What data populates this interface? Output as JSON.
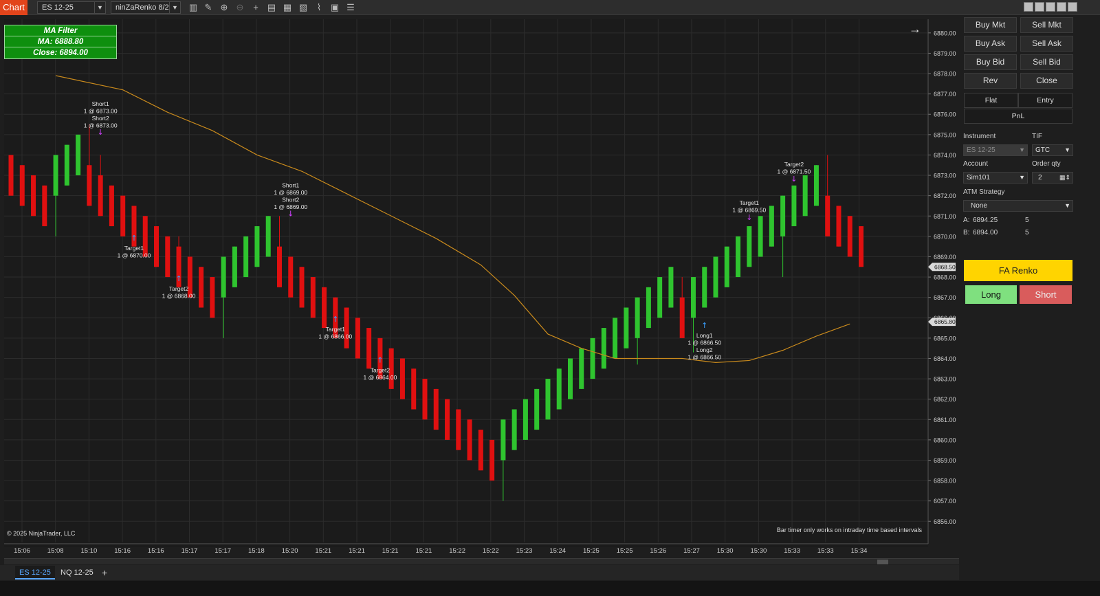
{
  "toolbar": {
    "chart_tab": "Chart",
    "instrument": "ES 12-25",
    "bar_type": "ninZaRenko 8/2",
    "icons": [
      "bar-style-icon",
      "draw-tool-icon",
      "zoom-in-icon",
      "zoom-out-icon",
      "crosshair-icon",
      "data-series-icon",
      "templates-icon",
      "indicators-icon",
      "strategies-icon",
      "properties-icon",
      "object-tree-icon"
    ]
  },
  "ma_filter": {
    "title": "MA Filter",
    "ma": "MA: 6888.80",
    "close": "Close: 6894.00"
  },
  "copyright": "© 2025 NinjaTrader, LLC",
  "bar_timer": "Bar timer only works on intraday time based intervals",
  "bottom_tabs": {
    "tab1": "ES 12-25",
    "tab2": "NQ 12-25",
    "add": "+"
  },
  "panel": {
    "buy_mkt": "Buy Mkt",
    "sell_mkt": "Sell Mkt",
    "buy_ask": "Buy Ask",
    "sell_ask": "Sell Ask",
    "buy_bid": "Buy Bid",
    "sell_bid": "Sell Bid",
    "rev": "Rev",
    "close": "Close",
    "flat": "Flat",
    "entry": "Entry",
    "pnl": "PnL",
    "instrument_label": "Instrument",
    "instrument_value": "ES 12-25",
    "tif_label": "TIF",
    "tif_value": "GTC",
    "account_label": "Account",
    "account_value": "Sim101",
    "qty_label": "Order qty",
    "qty_value": "2",
    "atm_label": "ATM Strategy",
    "atm_value": "None",
    "ask_label": "A:",
    "ask_price": "6894.25",
    "ask_size": "5",
    "bid_label": "B:",
    "bid_price": "6894.00",
    "bid_size": "5",
    "fa_renko": "FA Renko",
    "long": "Long",
    "short": "Short"
  },
  "colors": {
    "up": "#2fc42f",
    "down": "#e01010",
    "ma": "#c98a1c",
    "background": "#1e1e1e",
    "grid": "#2c2c2c"
  },
  "chart_data": {
    "type": "renko-candlestick",
    "y_axis_ticks": [
      6880,
      6879,
      6878,
      6877,
      6876,
      6875,
      6874,
      6873,
      6872,
      6871,
      6870,
      6869,
      6868,
      6867,
      6866,
      6865,
      6864,
      6863,
      6862,
      6861,
      6860,
      6859,
      6858,
      6857,
      6856
    ],
    "y_tick_labels": [
      "6880.00",
      "6879.00",
      "6878.00",
      "6877.00",
      "6876.00",
      "6875.00",
      "6874.00",
      "6873.00",
      "6872.00",
      "6871.00",
      "6870.00",
      "6869.00",
      "6868.00",
      "6867.00",
      "6866.00",
      "6865.00",
      "6864.00",
      "6863.00",
      "6862.00",
      "6861.00",
      "6860.00",
      "6859.00",
      "6858.00",
      "6057.00",
      "6856.00"
    ],
    "ylim": [
      6855.3,
      6880.4
    ],
    "price_markers": [
      "6868.50",
      "6865.80"
    ],
    "price_marker_values": [
      6868.5,
      6865.8
    ],
    "x_tick_labels": [
      "15:06",
      "15:08",
      "15:10",
      "15:16",
      "15:16",
      "15:17",
      "15:17",
      "15:18",
      "15:20",
      "15:21",
      "15:21",
      "15:21",
      "15:21",
      "15:22",
      "15:22",
      "15:23",
      "15:24",
      "15:25",
      "15:25",
      "15:26",
      "15:27",
      "15:30",
      "15:30",
      "15:33",
      "15:33",
      "15:34"
    ],
    "bars": [
      {
        "o": 6874,
        "c": 6872,
        "h": 6874,
        "l": 6872
      },
      {
        "o": 6873.5,
        "c": 6871.5,
        "h": 6873.5,
        "l": 6871.5
      },
      {
        "o": 6873,
        "c": 6871,
        "h": 6873,
        "l": 6871
      },
      {
        "o": 6872.5,
        "c": 6870.5,
        "h": 6872.5,
        "l": 6870.5
      },
      {
        "o": 6872,
        "c": 6874,
        "h": 6874,
        "l": 6870
      },
      {
        "o": 6872.5,
        "c": 6874.5,
        "h": 6874.5,
        "l": 6872.5
      },
      {
        "o": 6873,
        "c": 6875,
        "h": 6875,
        "l": 6873
      },
      {
        "o": 6873.5,
        "c": 6871.5,
        "h": 6875.5,
        "l": 6871.5
      },
      {
        "o": 6873,
        "c": 6871,
        "h": 6874,
        "l": 6871
      },
      {
        "o": 6872.5,
        "c": 6870.5,
        "h": 6872.5,
        "l": 6870.5
      },
      {
        "o": 6872,
        "c": 6870,
        "h": 6872,
        "l": 6870
      },
      {
        "o": 6871.5,
        "c": 6869.5,
        "h": 6871.5,
        "l": 6869.5
      },
      {
        "o": 6871,
        "c": 6869,
        "h": 6871,
        "l": 6869
      },
      {
        "o": 6870.5,
        "c": 6868.5,
        "h": 6870.5,
        "l": 6868.5
      },
      {
        "o": 6870,
        "c": 6868,
        "h": 6870,
        "l": 6868
      },
      {
        "o": 6869.5,
        "c": 6867.5,
        "h": 6870,
        "l": 6867.5
      },
      {
        "o": 6869,
        "c": 6867,
        "h": 6869,
        "l": 6867
      },
      {
        "o": 6868.5,
        "c": 6866.5,
        "h": 6868.5,
        "l": 6866.5
      },
      {
        "o": 6868,
        "c": 6866,
        "h": 6868,
        "l": 6866
      },
      {
        "o": 6867,
        "c": 6869,
        "h": 6869,
        "l": 6865
      },
      {
        "o": 6867.5,
        "c": 6869.5,
        "h": 6869.5,
        "l": 6867.5
      },
      {
        "o": 6868,
        "c": 6870,
        "h": 6870,
        "l": 6868
      },
      {
        "o": 6868.5,
        "c": 6870.5,
        "h": 6870.5,
        "l": 6868.5
      },
      {
        "o": 6869,
        "c": 6871,
        "h": 6871,
        "l": 6869
      },
      {
        "o": 6869.5,
        "c": 6867.5,
        "h": 6871,
        "l": 6867.5
      },
      {
        "o": 6869,
        "c": 6867,
        "h": 6869,
        "l": 6867
      },
      {
        "o": 6868.5,
        "c": 6866.5,
        "h": 6868.5,
        "l": 6866.5
      },
      {
        "o": 6868,
        "c": 6866,
        "h": 6868,
        "l": 6866
      },
      {
        "o": 6867.5,
        "c": 6865.5,
        "h": 6867.5,
        "l": 6865.5
      },
      {
        "o": 6867,
        "c": 6865,
        "h": 6867,
        "l": 6865
      },
      {
        "o": 6866.5,
        "c": 6864.5,
        "h": 6866.5,
        "l": 6864.5
      },
      {
        "o": 6866,
        "c": 6864,
        "h": 6866,
        "l": 6864
      },
      {
        "o": 6865.5,
        "c": 6863.5,
        "h": 6865.5,
        "l": 6863.5
      },
      {
        "o": 6865,
        "c": 6863,
        "h": 6865,
        "l": 6863
      },
      {
        "o": 6864.5,
        "c": 6862.5,
        "h": 6864.5,
        "l": 6862.5
      },
      {
        "o": 6864,
        "c": 6862,
        "h": 6864,
        "l": 6862
      },
      {
        "o": 6863.5,
        "c": 6861.5,
        "h": 6863.5,
        "l": 6861.5
      },
      {
        "o": 6863,
        "c": 6861,
        "h": 6863,
        "l": 6861
      },
      {
        "o": 6862.5,
        "c": 6860.5,
        "h": 6862.5,
        "l": 6860.5
      },
      {
        "o": 6862,
        "c": 6860,
        "h": 6862,
        "l": 6860
      },
      {
        "o": 6861.5,
        "c": 6859.5,
        "h": 6861.5,
        "l": 6859.5
      },
      {
        "o": 6861,
        "c": 6859,
        "h": 6861,
        "l": 6859
      },
      {
        "o": 6860.5,
        "c": 6858.5,
        "h": 6860.5,
        "l": 6858.5
      },
      {
        "o": 6860,
        "c": 6858,
        "h": 6860,
        "l": 6858
      },
      {
        "o": 6859,
        "c": 6861,
        "h": 6861,
        "l": 6857
      },
      {
        "o": 6859.5,
        "c": 6861.5,
        "h": 6861.5,
        "l": 6859.5
      },
      {
        "o": 6860,
        "c": 6862,
        "h": 6862,
        "l": 6860
      },
      {
        "o": 6860.5,
        "c": 6862.5,
        "h": 6862.5,
        "l": 6860.5
      },
      {
        "o": 6861,
        "c": 6863,
        "h": 6863,
        "l": 6861
      },
      {
        "o": 6861.5,
        "c": 6863.5,
        "h": 6863.5,
        "l": 6861.5
      },
      {
        "o": 6862,
        "c": 6864,
        "h": 6864,
        "l": 6862
      },
      {
        "o": 6862.5,
        "c": 6864.5,
        "h": 6864.5,
        "l": 6862.5
      },
      {
        "o": 6863,
        "c": 6865,
        "h": 6865,
        "l": 6863
      },
      {
        "o": 6863.5,
        "c": 6865.5,
        "h": 6865.5,
        "l": 6863.5
      },
      {
        "o": 6864,
        "c": 6866,
        "h": 6866,
        "l": 6864
      },
      {
        "o": 6864.5,
        "c": 6866.5,
        "h": 6866.5,
        "l": 6864.5
      },
      {
        "o": 6865,
        "c": 6867,
        "h": 6867,
        "l": 6863.7
      },
      {
        "o": 6865.5,
        "c": 6867.5,
        "h": 6867.5,
        "l": 6865.5
      },
      {
        "o": 6866,
        "c": 6868,
        "h": 6868,
        "l": 6866
      },
      {
        "o": 6866.5,
        "c": 6868.5,
        "h": 6868.5,
        "l": 6866.5
      },
      {
        "o": 6867,
        "c": 6865,
        "h": 6868,
        "l": 6865
      },
      {
        "o": 6866,
        "c": 6868,
        "h": 6868,
        "l": 6864.3
      },
      {
        "o": 6866.5,
        "c": 6868.5,
        "h": 6868.5,
        "l": 6866.5
      },
      {
        "o": 6867,
        "c": 6869,
        "h": 6869,
        "l": 6867
      },
      {
        "o": 6867.5,
        "c": 6869.5,
        "h": 6869.5,
        "l": 6867.5
      },
      {
        "o": 6868,
        "c": 6870,
        "h": 6870,
        "l": 6868
      },
      {
        "o": 6868.5,
        "c": 6870.5,
        "h": 6870.5,
        "l": 6868.5
      },
      {
        "o": 6869,
        "c": 6871,
        "h": 6871,
        "l": 6869
      },
      {
        "o": 6869.5,
        "c": 6871.5,
        "h": 6871.5,
        "l": 6869.5
      },
      {
        "o": 6870,
        "c": 6872,
        "h": 6872,
        "l": 6868
      },
      {
        "o": 6870.5,
        "c": 6872.5,
        "h": 6872.5,
        "l": 6870.5
      },
      {
        "o": 6871,
        "c": 6873,
        "h": 6873,
        "l": 6871
      },
      {
        "o": 6871.5,
        "c": 6873.5,
        "h": 6873.5,
        "l": 6871.5
      },
      {
        "o": 6872,
        "c": 6870,
        "h": 6874,
        "l": 6870
      },
      {
        "o": 6871.5,
        "c": 6869.5,
        "h": 6871.5,
        "l": 6869.5
      },
      {
        "o": 6871,
        "c": 6869,
        "h": 6871,
        "l": 6869
      },
      {
        "o": 6870.5,
        "c": 6868.5,
        "h": 6870.5,
        "l": 6868.5
      }
    ],
    "ma_line": [
      {
        "i": 4,
        "v": 6877.9
      },
      {
        "i": 10,
        "v": 6877.2
      },
      {
        "i": 14,
        "v": 6876.1
      },
      {
        "i": 18,
        "v": 6875.2
      },
      {
        "i": 22,
        "v": 6874
      },
      {
        "i": 26,
        "v": 6873.2
      },
      {
        "i": 30,
        "v": 6872.1
      },
      {
        "i": 34,
        "v": 6871
      },
      {
        "i": 38,
        "v": 6869.9
      },
      {
        "i": 42,
        "v": 6868.6
      },
      {
        "i": 45,
        "v": 6867.1
      },
      {
        "i": 48,
        "v": 6865.2
      },
      {
        "i": 51,
        "v": 6864.5
      },
      {
        "i": 54,
        "v": 6864
      },
      {
        "i": 57,
        "v": 6864
      },
      {
        "i": 60,
        "v": 6864
      },
      {
        "i": 63,
        "v": 6863.8
      },
      {
        "i": 66,
        "v": 6863.9
      },
      {
        "i": 69,
        "v": 6864.4
      },
      {
        "i": 72,
        "v": 6865.1
      },
      {
        "i": 75,
        "v": 6865.7
      }
    ],
    "signals": [
      {
        "i": 8,
        "v": 6875,
        "dir": "down",
        "text": [
          "Short1",
          "1 @ 6873.00",
          "Short2",
          "1 @ 6873.00"
        ]
      },
      {
        "i": 11,
        "v": 6869.8,
        "dir": "up",
        "text": [
          "Target1",
          "1 @ 6870.00"
        ]
      },
      {
        "i": 15,
        "v": 6867.8,
        "dir": "up",
        "text": [
          "Target2",
          "1 @ 6868.00"
        ]
      },
      {
        "i": 25,
        "v": 6871,
        "dir": "down",
        "text": [
          "Short1",
          "1 @ 6869.00",
          "Short2",
          "1 @ 6869.00"
        ]
      },
      {
        "i": 29,
        "v": 6865.8,
        "dir": "up",
        "text": [
          "Target1",
          "1 @ 6866.00"
        ]
      },
      {
        "i": 33,
        "v": 6863.8,
        "dir": "up",
        "text": [
          "Target2",
          "1 @ 6864.00"
        ]
      },
      {
        "i": 62,
        "v": 6865.5,
        "dir": "up",
        "text": [
          "Long1",
          "1 @ 6866.50",
          "Long2",
          "1 @ 6866.50"
        ]
      },
      {
        "i": 66,
        "v": 6870.8,
        "dir": "down",
        "text": [
          "Target1",
          "1 @ 6869.50"
        ]
      },
      {
        "i": 70,
        "v": 6872.7,
        "dir": "down",
        "text": [
          "Target2",
          "1 @ 6871.50"
        ]
      }
    ]
  }
}
